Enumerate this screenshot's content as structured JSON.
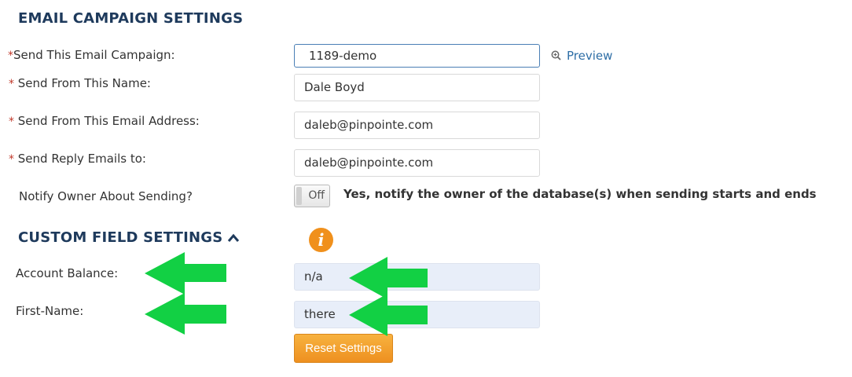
{
  "email_section": {
    "title": "EMAIL CAMPAIGN SETTINGS",
    "required_marker": "*",
    "fields": {
      "campaign": {
        "label": "Send This Email Campaign:",
        "value": "1189-demo"
      },
      "from_name": {
        "label": "Send From This Name:",
        "value": "Dale Boyd"
      },
      "from_email": {
        "label": "Send From This Email Address:",
        "value": "daleb@pinpointe.com"
      },
      "reply_to": {
        "label": "Send Reply Emails to:",
        "value": "daleb@pinpointe.com"
      }
    },
    "preview_label": "Preview",
    "notify": {
      "label": "Notify Owner About Sending?",
      "toggle_state": "Off",
      "description": "Yes, notify the owner of the database(s) when sending starts and ends"
    }
  },
  "custom_section": {
    "title": "CUSTOM FIELD SETTINGS",
    "collapse_icon": "chevron-up-icon",
    "info_icon": "info-icon",
    "info_glyph": "i",
    "fields": {
      "account_balance": {
        "label": "Account Balance:",
        "value": "n/a"
      },
      "first_name": {
        "label": "First-Name:",
        "value": "there"
      }
    },
    "reset_label": "Reset Settings"
  },
  "annotations": {
    "arrow_color": "#12d044"
  },
  "colors": {
    "heading": "#1e3a5c",
    "required": "#c0392b",
    "link": "#2e6ea6",
    "button": "#f0a030",
    "custom_field_bg": "#e8eef9"
  }
}
